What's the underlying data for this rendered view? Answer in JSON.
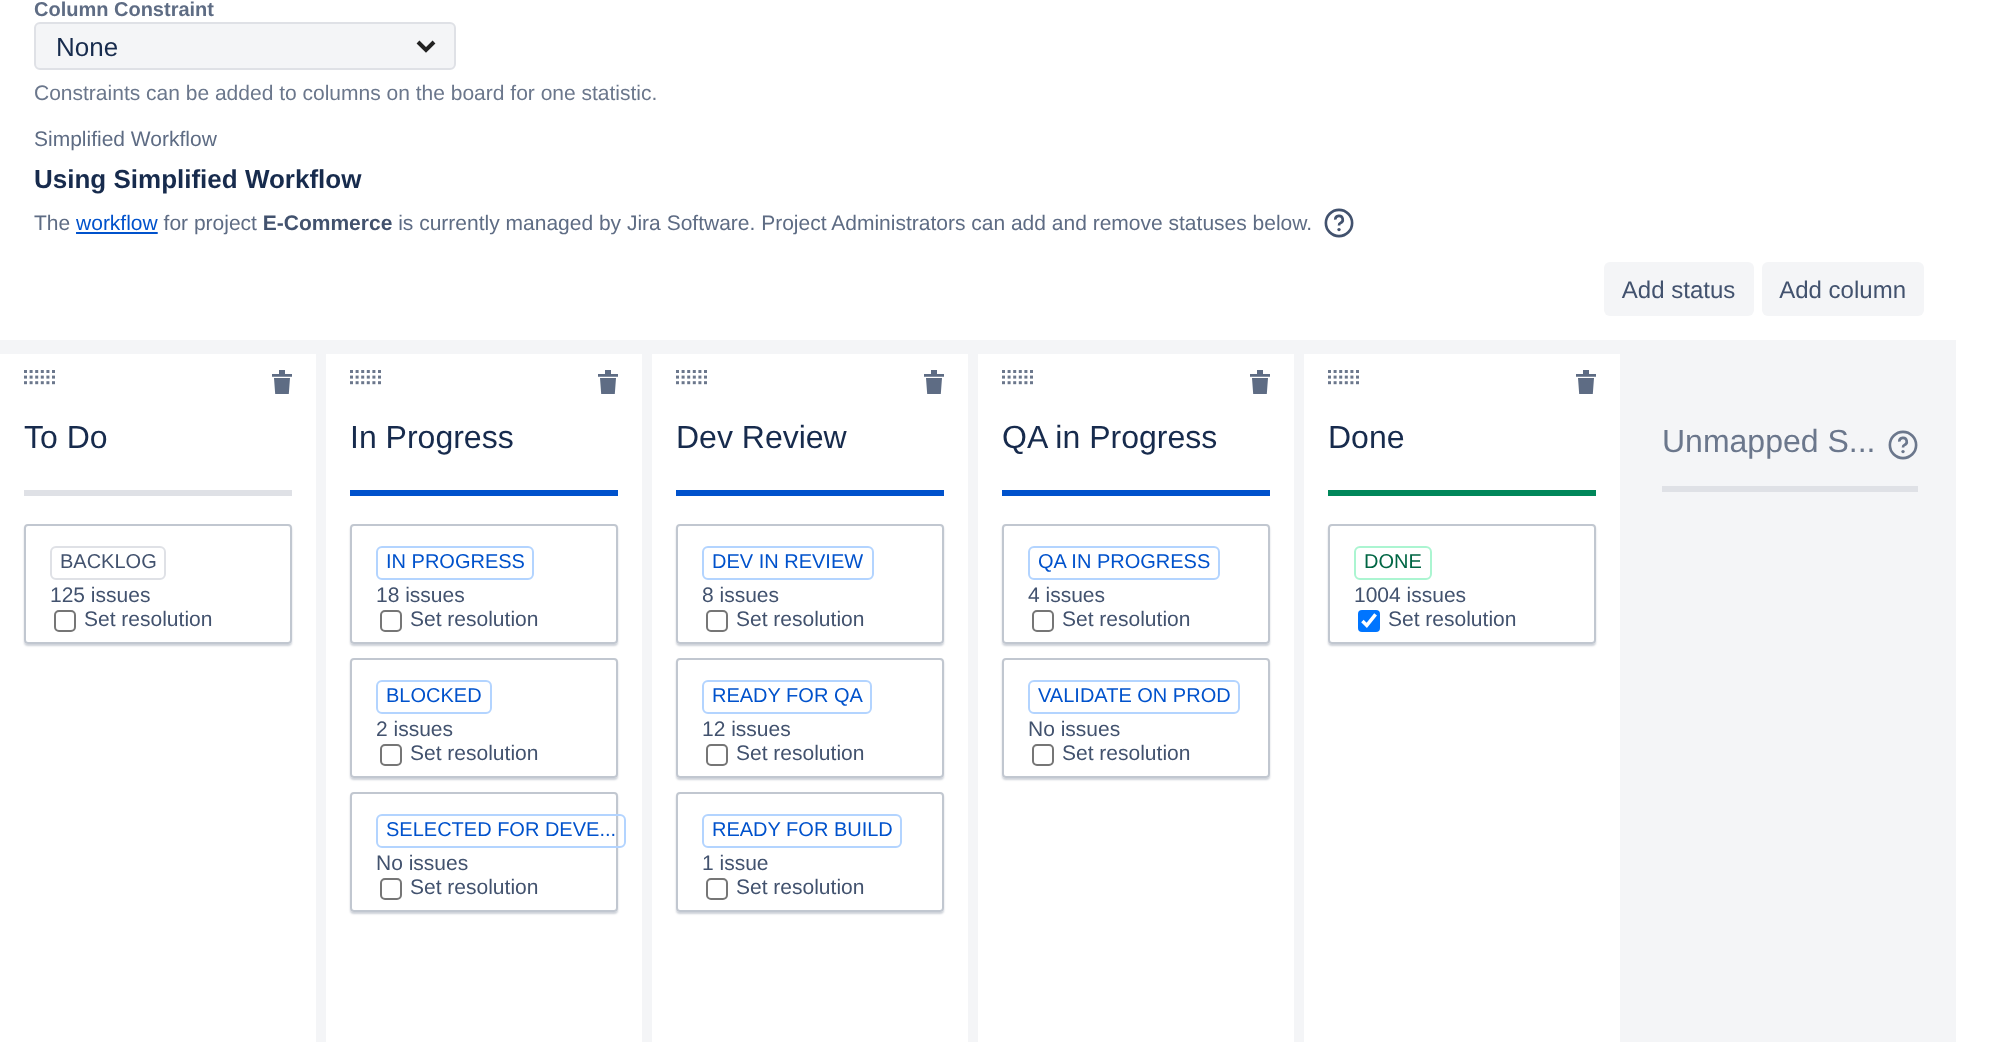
{
  "constraint": {
    "label": "Column Constraint",
    "value": "None",
    "help": "Constraints can be added to columns on the board for one statistic."
  },
  "workflow": {
    "label": "Simplified Workflow",
    "heading": "Using Simplified Workflow",
    "text_before": "The",
    "link": "workflow",
    "text_after": "for project **E-Commerce** is currently managed by Jira Software. Project Administrators can add and remove statuses below."
  },
  "actions": [
    "Add status",
    "Add column"
  ],
  "columns": [
    {
      "title": "To Do",
      "kind": "todo",
      "statuses": [
        {
          "name": "BACKLOG",
          "kind": "todo",
          "count": "125 issues",
          "resolution": "Set resolution",
          "checked": false
        }
      ]
    },
    {
      "title": "In Progress",
      "kind": "inprogress",
      "statuses": [
        {
          "name": "IN PROGRESS",
          "kind": "inprogress",
          "count": "18 issues",
          "resolution": "Set resolution",
          "checked": false
        },
        {
          "name": "BLOCKED",
          "kind": "inprogress",
          "count": "2 issues",
          "resolution": "Set resolution",
          "checked": false
        },
        {
          "name": "SELECTED FOR DEVE...",
          "kind": "inprogress",
          "count": "No issues",
          "resolution": "Set resolution",
          "checked": false
        }
      ]
    },
    {
      "title": "Dev Review",
      "kind": "inprogress",
      "statuses": [
        {
          "name": "DEV IN REVIEW",
          "kind": "inprogress",
          "count": "8 issues",
          "resolution": "Set resolution",
          "checked": false
        },
        {
          "name": "READY FOR QA",
          "kind": "inprogress",
          "count": "12 issues",
          "resolution": "Set resolution",
          "checked": false
        },
        {
          "name": "READY FOR BUILD",
          "kind": "inprogress",
          "count": "1 issue",
          "resolution": "Set resolution",
          "checked": false
        }
      ]
    },
    {
      "title": "QA in Progress",
      "kind": "inprogress",
      "statuses": [
        {
          "name": "QA IN PROGRESS",
          "kind": "inprogress",
          "count": "4 issues",
          "resolution": "Set resolution",
          "checked": false
        },
        {
          "name": "VALIDATE ON PROD",
          "kind": "inprogress",
          "count": "No issues",
          "resolution": "Set resolution",
          "checked": false
        }
      ]
    },
    {
      "title": "Done",
      "kind": "done",
      "statuses": [
        {
          "name": "DONE",
          "kind": "done",
          "count": "1004 issues",
          "resolution": "Set resolution",
          "checked": true
        }
      ]
    }
  ],
  "unmapped": {
    "title": "Unmapped S..."
  }
}
